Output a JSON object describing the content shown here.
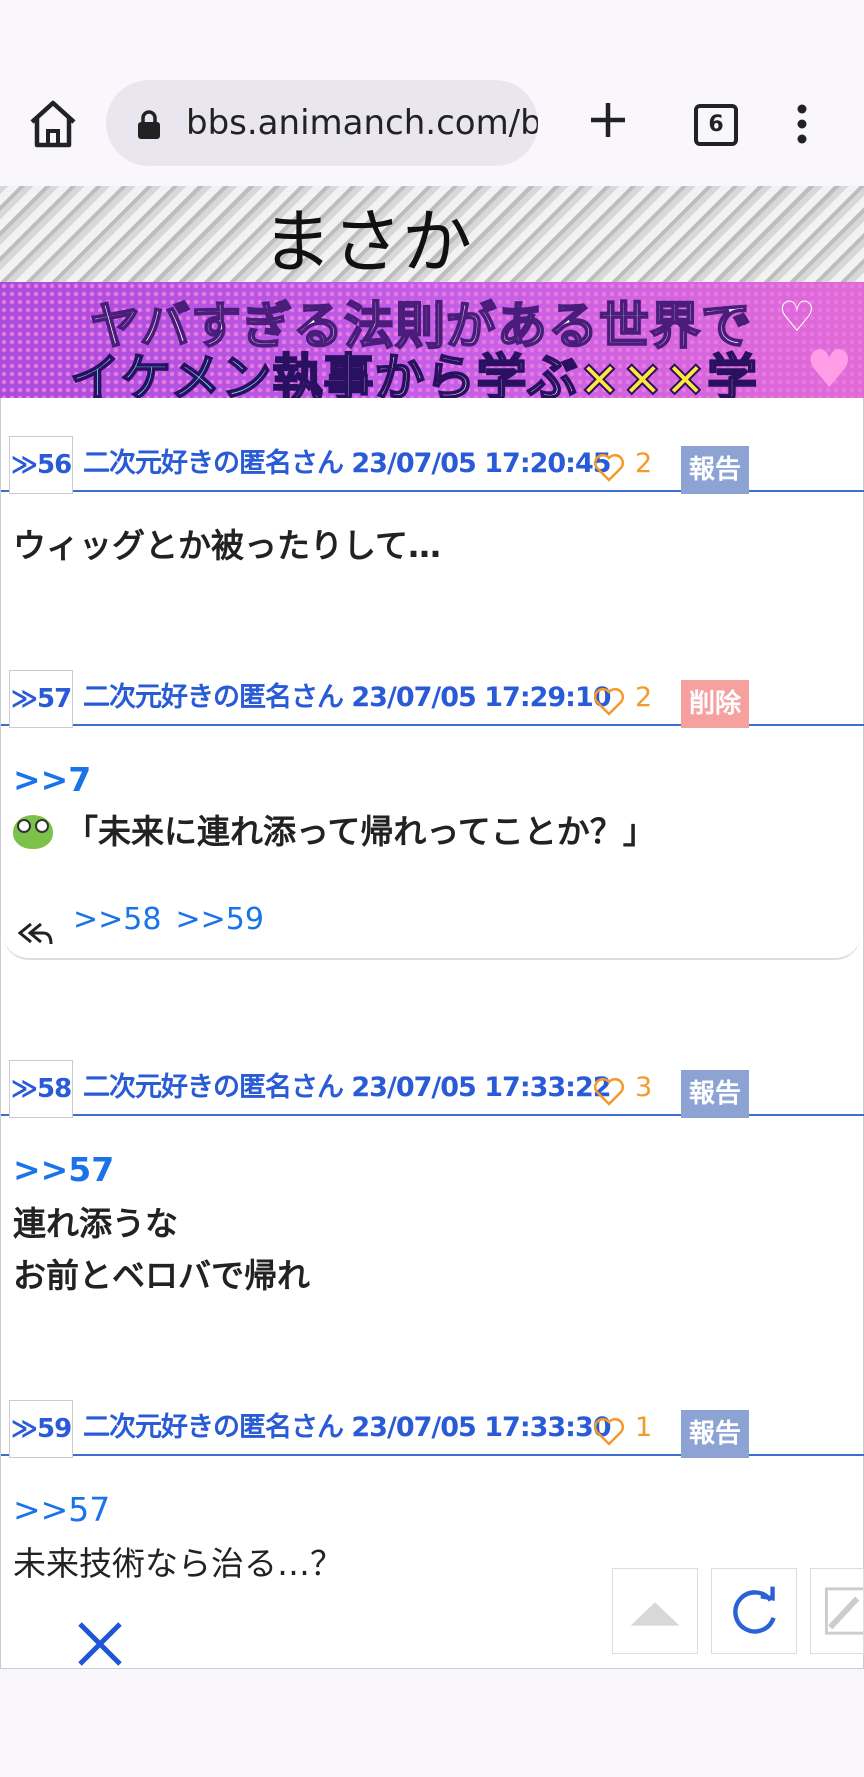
{
  "browser": {
    "url": "bbs.animanch.com/b",
    "tab_count": "6"
  },
  "banner": {
    "top_text": "まさか",
    "line1": "ヤバすぎる法則がある世界で",
    "line2a": "イケメン",
    "line2b": "執事",
    "line2c": "から学ぶ",
    "line2d": "×××学"
  },
  "posts": [
    {
      "number": "≫56",
      "meta": "二次元好きの匿名さん 23/07/05 17:20:45",
      "likes": "2",
      "action": "報告",
      "lines": [
        "ウィッグとか被ったりして…"
      ]
    },
    {
      "number": "≫57",
      "meta": "二次元好きの匿名さん 23/07/05 17:29:10",
      "likes": "2",
      "action": "削除",
      "anchor": ">>7",
      "lines": [
        "「未来に連れ添って帰れってことか？」"
      ],
      "replies": [
        ">>58",
        ">>59"
      ]
    },
    {
      "number": "≫58",
      "meta": "二次元好きの匿名さん 23/07/05 17:33:22",
      "likes": "3",
      "action": "報告",
      "anchor": ">>57",
      "lines": [
        "連れ添うな",
        "お前とベロバで帰れ"
      ]
    },
    {
      "number": "≫59",
      "meta": "二次元好きの匿名さん 23/07/05 17:33:30",
      "likes": "1",
      "action": "報告",
      "anchor": ">>57",
      "lines": [
        "未来技術なら治る…？"
      ]
    }
  ],
  "icons": {
    "home": "home-icon",
    "lock": "lock-icon",
    "new_tab": "plus-icon",
    "menu": "more-vert-icon",
    "like": "heart-icon",
    "reply": "reply-all-icon",
    "scroll_top": "triangle-up-icon",
    "reload": "refresh-icon",
    "write": "pencil-icon",
    "close": "close-icon"
  },
  "colors": {
    "link_blue": "#1a73e8",
    "meta_blue": "#2a5bd7",
    "like_orange": "#f39a2b",
    "report_bg": "#8ca3d4",
    "delete_bg": "#f6a0a0"
  }
}
